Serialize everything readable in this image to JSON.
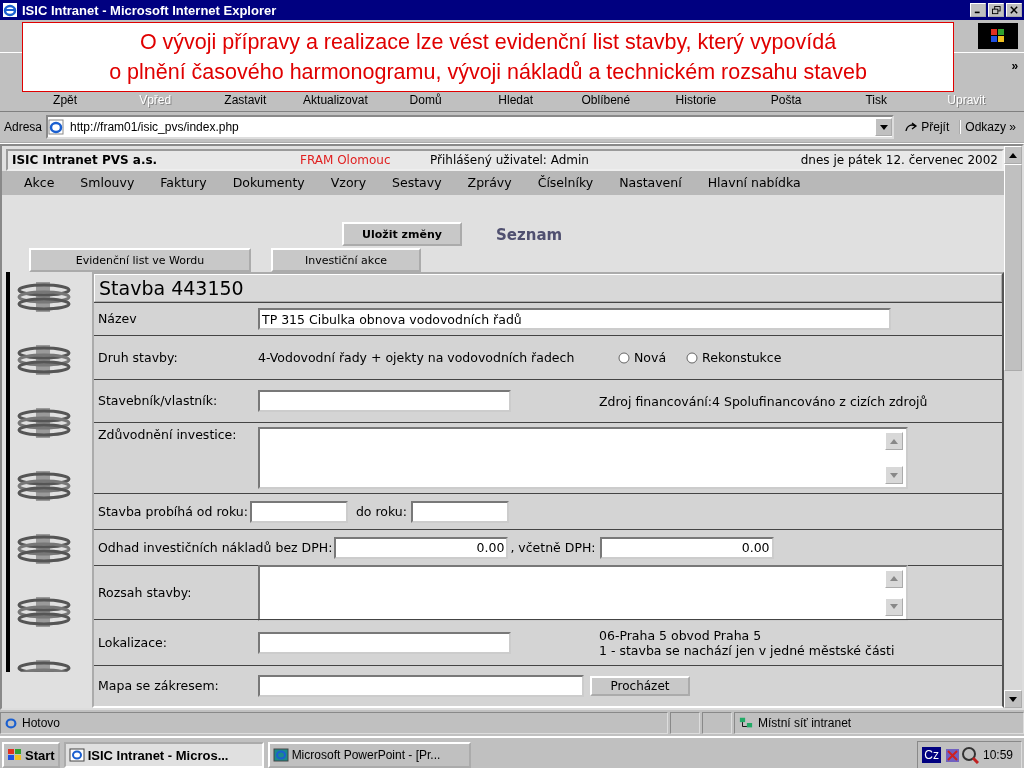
{
  "window": {
    "title": "ISIC Intranet - Microsoft Internet Explorer"
  },
  "callout": {
    "lines": [
      "O vývoji přípravy a realizace lze vést evidenční list stavby, který vypovídá",
      "o plnění časového harmonogramu, vývoji nákladů a technickém rozsahu staveb"
    ]
  },
  "toolbar": [
    {
      "label": "Zpět",
      "disabled": false
    },
    {
      "label": "Vpřed",
      "disabled": true
    },
    {
      "label": "Zastavit",
      "disabled": false
    },
    {
      "label": "Aktualizovat",
      "disabled": false
    },
    {
      "label": "Domů",
      "disabled": false
    },
    {
      "label": "Hledat",
      "disabled": false
    },
    {
      "label": "Oblíbené",
      "disabled": false
    },
    {
      "label": "Historie",
      "disabled": false
    },
    {
      "label": "Pošta",
      "disabled": false
    },
    {
      "label": "Tisk",
      "disabled": false
    },
    {
      "label": "Upravit",
      "disabled": true
    }
  ],
  "address_bar": {
    "label": "Adresa",
    "url": "http://fram01/isic_pvs/index.php",
    "go": "Přejít",
    "links": "Odkazy",
    "more": "»"
  },
  "page": {
    "header": {
      "company": "ISIC Intranet PVS a.s.",
      "branch": "FRAM Olomouc",
      "user": "Přihlášený uživatel: Admin",
      "date": "dnes je pátek 12. červenec 2002"
    },
    "menu": [
      "Akce",
      "Smlouvy",
      "Faktury",
      "Dokumenty",
      "Vzory",
      "Sestavy",
      "Zprávy",
      "Číselníky",
      "Nastavení",
      "Hlavní nabídka"
    ],
    "save_button": "Uložit změny",
    "list_link": "Seznam",
    "tabs": [
      "Evidenční list ve Wordu",
      "Investiční akce"
    ],
    "form": {
      "title": "Stavba 443150",
      "rows": [
        {
          "kind": "text",
          "label": "Název",
          "value": "TP 315 Cibulka obnova vodovodních řadů"
        },
        {
          "kind": "radio",
          "label": "Druh stavby:",
          "info": "4-Vodovodní řady + ojekty na vodovodních řadech",
          "options": [
            {
              "label": "Nová",
              "selected": false
            },
            {
              "label": "Rekonstukce",
              "selected": false
            }
          ]
        },
        {
          "kind": "text_info",
          "label": "Stavebník/vlastník:",
          "info": [
            "Zdroj financování:4 Spolufinancováno z cizích zdrojů"
          ]
        },
        {
          "kind": "textarea",
          "label": "Zdůvodnění investice:"
        },
        {
          "kind": "years",
          "label": "Stavba probíhá od roku:",
          "label2": "do roku:"
        },
        {
          "kind": "cost",
          "label": "Odhad investičních nákladů bez DPH:",
          "value": "0.00",
          "label2": ", včetně DPH:",
          "value2": "0.00"
        },
        {
          "kind": "textarea",
          "label": "Rozsah stavby:"
        },
        {
          "kind": "text_info",
          "label": "Lokalizace:",
          "info": [
            "06-Praha 5 obvod Praha 5",
            "1 - stavba se nachází jen v jedné městské části"
          ]
        },
        {
          "kind": "file",
          "label": "Mapa se zákresem:",
          "button": "Procházet"
        }
      ]
    }
  },
  "status_bar": {
    "text": "Hotovo",
    "zone": "Místní síť intranet"
  },
  "taskbar": {
    "start": "Start",
    "tasks": [
      {
        "label": "ISIC Intranet - Micros...",
        "selected": true
      },
      {
        "label": "Microsoft PowerPoint - [Pr...",
        "selected": false
      }
    ],
    "lang": "Cz",
    "time": "10:59"
  }
}
